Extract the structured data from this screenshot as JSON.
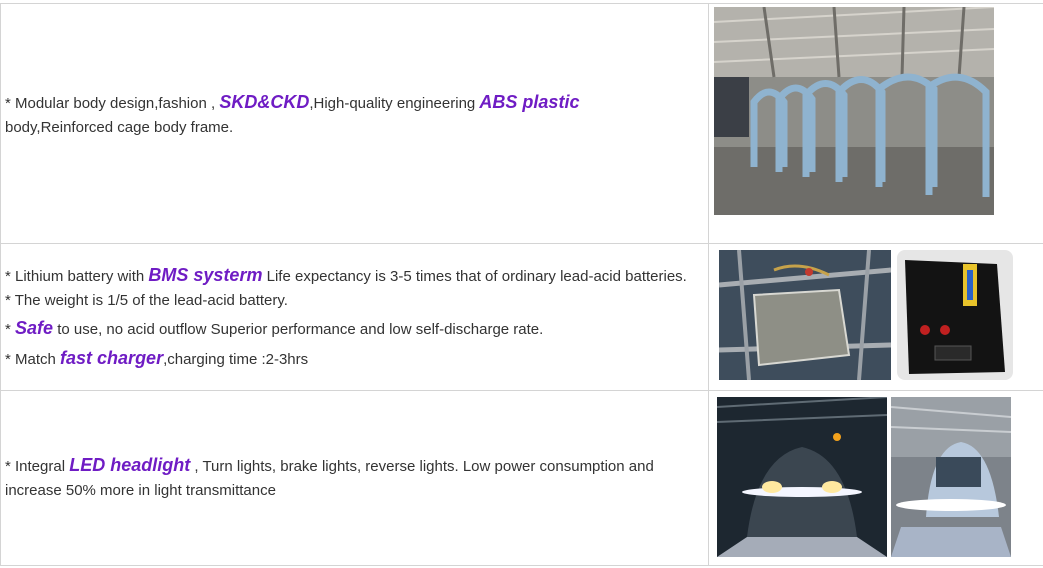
{
  "rows": [
    {
      "lines": [
        {
          "parts": [
            "* Modular body design,fashion ,  ",
            "SKD&CKD",
            ",High-quality engineering ",
            "ABS plastic",
            " body,Reinforced cage body frame."
          ]
        }
      ],
      "images": [
        "factory-body-frames-photo"
      ]
    },
    {
      "lines": [
        {
          "parts": [
            "* Lithium battery with ",
            "BMS systerm",
            "  Life expectancy is 3-5 times that of ordinary lead-acid batteries."
          ]
        },
        {
          "parts": [
            "* The weight is 1/5 of the lead-acid battery."
          ]
        },
        {
          "parts": [
            "* ",
            "Safe",
            " to use, no acid outflow Superior performance and low self-discharge rate."
          ]
        },
        {
          "parts": [
            "* Match ",
            "fast charger",
            ",charging time :2-3hrs"
          ]
        }
      ],
      "images": [
        "battery-pack-installed-photo",
        "lithium-battery-box-photo"
      ]
    },
    {
      "lines": [
        {
          "parts": [
            "* Integral ",
            "LED headlight",
            " , Turn lights, brake lights, reverse lights. Low power consumption and increase 50% more in light transmittance"
          ]
        }
      ],
      "images": [
        "led-headlight-front-photo",
        "led-headlight-side-photo"
      ]
    }
  ],
  "colors": {
    "highlight": "#6f1cc4",
    "body_text": "#333333",
    "border": "#d4d4d4"
  }
}
